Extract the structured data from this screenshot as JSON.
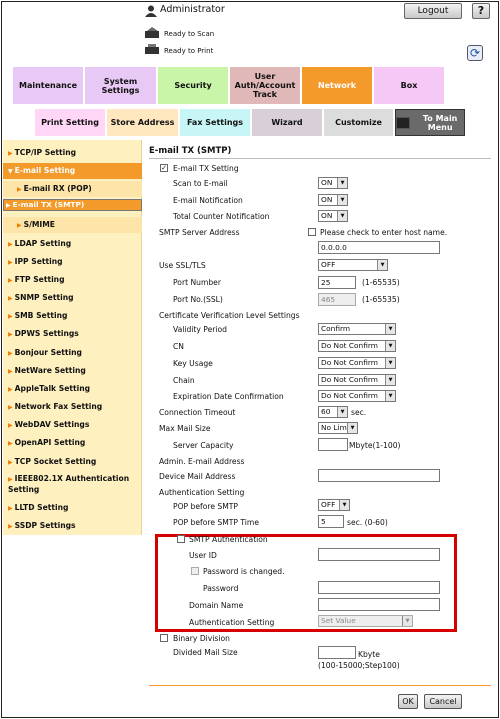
{
  "header": {
    "user": "Administrator",
    "logout": "Logout",
    "help": "?",
    "status_scan": "Ready to Scan",
    "status_print": "Ready to Print"
  },
  "tabs_top": [
    {
      "label": "Maintenance",
      "bg": "#e8c8f5"
    },
    {
      "label": "System Settings",
      "bg": "#e8c8f5"
    },
    {
      "label": "Security",
      "bg": "#c8f5a8"
    },
    {
      "label": "User Auth/Account Track",
      "bg": "#e0b8b8"
    },
    {
      "label": "Network",
      "bg": "#f39a2b",
      "color": "#ffffff"
    },
    {
      "label": "Box",
      "bg": "#f5c8f5"
    }
  ],
  "tabs_sub": [
    {
      "label": "Print Setting",
      "bg": "#ffd6f5"
    },
    {
      "label": "Store Address",
      "bg": "#ffe8c0"
    },
    {
      "label": "Fax Settings",
      "bg": "#c8f5f5"
    },
    {
      "label": "Wizard",
      "bg": "#d8cfd8"
    },
    {
      "label": "Customize",
      "bg": "#dcdcdc"
    },
    {
      "label": "To Main Menu",
      "bg": "#6a6a6a"
    }
  ],
  "sidebar": [
    {
      "label": "TCP/IP Setting",
      "style": "item"
    },
    {
      "label": "E-mail Setting",
      "style": "selected-open"
    },
    {
      "label": "E-mail RX (POP)",
      "style": "sub"
    },
    {
      "label": "E-mail TX (SMTP)",
      "style": "sub-selected"
    },
    {
      "label": "S/MIME",
      "style": "sub"
    },
    {
      "label": "LDAP Setting",
      "style": "item"
    },
    {
      "label": "IPP Setting",
      "style": "item"
    },
    {
      "label": "FTP Setting",
      "style": "item"
    },
    {
      "label": "SNMP Setting",
      "style": "item"
    },
    {
      "label": "SMB Setting",
      "style": "item"
    },
    {
      "label": "DPWS Settings",
      "style": "item"
    },
    {
      "label": "Bonjour Setting",
      "style": "item"
    },
    {
      "label": "NetWare Setting",
      "style": "item"
    },
    {
      "label": "AppleTalk Setting",
      "style": "item"
    },
    {
      "label": "Network Fax Setting",
      "style": "item"
    },
    {
      "label": "WebDAV Settings",
      "style": "item"
    },
    {
      "label": "OpenAPI Setting",
      "style": "item"
    },
    {
      "label": "TCP Socket Setting",
      "style": "item"
    },
    {
      "label": "IEEE802.1X Authentication Setting",
      "style": "item"
    },
    {
      "label": "LLTD Setting",
      "style": "item"
    },
    {
      "label": "SSDP Settings",
      "style": "item"
    }
  ],
  "form": {
    "title": "E-mail TX (SMTP)",
    "email_tx_setting": "E-mail TX Setting",
    "scan_to_email": "Scan to E-mail",
    "scan_to_email_value": "ON",
    "email_notification": "E-mail Notification",
    "email_notification_value": "ON",
    "total_counter_notification": "Total Counter Notification",
    "total_counter_notification_value": "ON",
    "smtp_server_address": "SMTP Server Address",
    "host_name_check": "Please check to enter host name.",
    "smtp_server_value": "0.0.0.0",
    "use_ssl_tls": "Use SSL/TLS",
    "use_ssl_tls_value": "OFF",
    "port_number": "Port Number",
    "port_number_value": "25",
    "port_range": "(1-65535)",
    "port_ssl": "Port No.(SSL)",
    "port_ssl_value": "465",
    "port_ssl_range": "(1-65535)",
    "cert_verification": "Certificate Verification Level Settings",
    "validity_period": "Validity Period",
    "validity_period_value": "Confirm",
    "cn": "CN",
    "cn_value": "Do Not Confirm",
    "key_usage": "Key Usage",
    "key_usage_value": "Do Not Confirm",
    "chain": "Chain",
    "chain_value": "Do Not Confirm",
    "expiration_date": "Expiration Date Confirmation",
    "expiration_date_value": "Do Not Confirm",
    "connection_timeout": "Connection Timeout",
    "connection_timeout_value": "60",
    "sec": "sec.",
    "max_mail_size": "Max Mail Size",
    "max_mail_size_value": "No Limit",
    "server_capacity": "Server Capacity",
    "server_capacity_unit": "Mbyte(1-100)",
    "admin_email": "Admin. E-mail Address",
    "device_mail": "Device Mail Address",
    "authentication_setting": "Authentication Setting",
    "pop_before_smtp": "POP before SMTP",
    "pop_before_smtp_value": "OFF",
    "pop_before_smtp_time": "POP before SMTP Time",
    "pop_before_smtp_time_value": "5",
    "pop_time_unit": "sec. (0-60)",
    "smtp_authentication": "SMTP Authentication",
    "user_id": "User ID",
    "password_changed": "Password is changed.",
    "password": "Password",
    "domain_name": "Domain Name",
    "auth_setting": "Authentication Setting",
    "auth_setting_value": "Set Value",
    "binary_division": "Binary Division",
    "divided_mail_size": "Divided Mail Size",
    "divided_unit": "Kbyte",
    "divided_range": "(100-15000;Step100)"
  },
  "buttons": {
    "ok": "OK",
    "cancel": "Cancel"
  },
  "colors": {
    "highlight_box": "#d70000",
    "accent": "#f39a2b"
  }
}
